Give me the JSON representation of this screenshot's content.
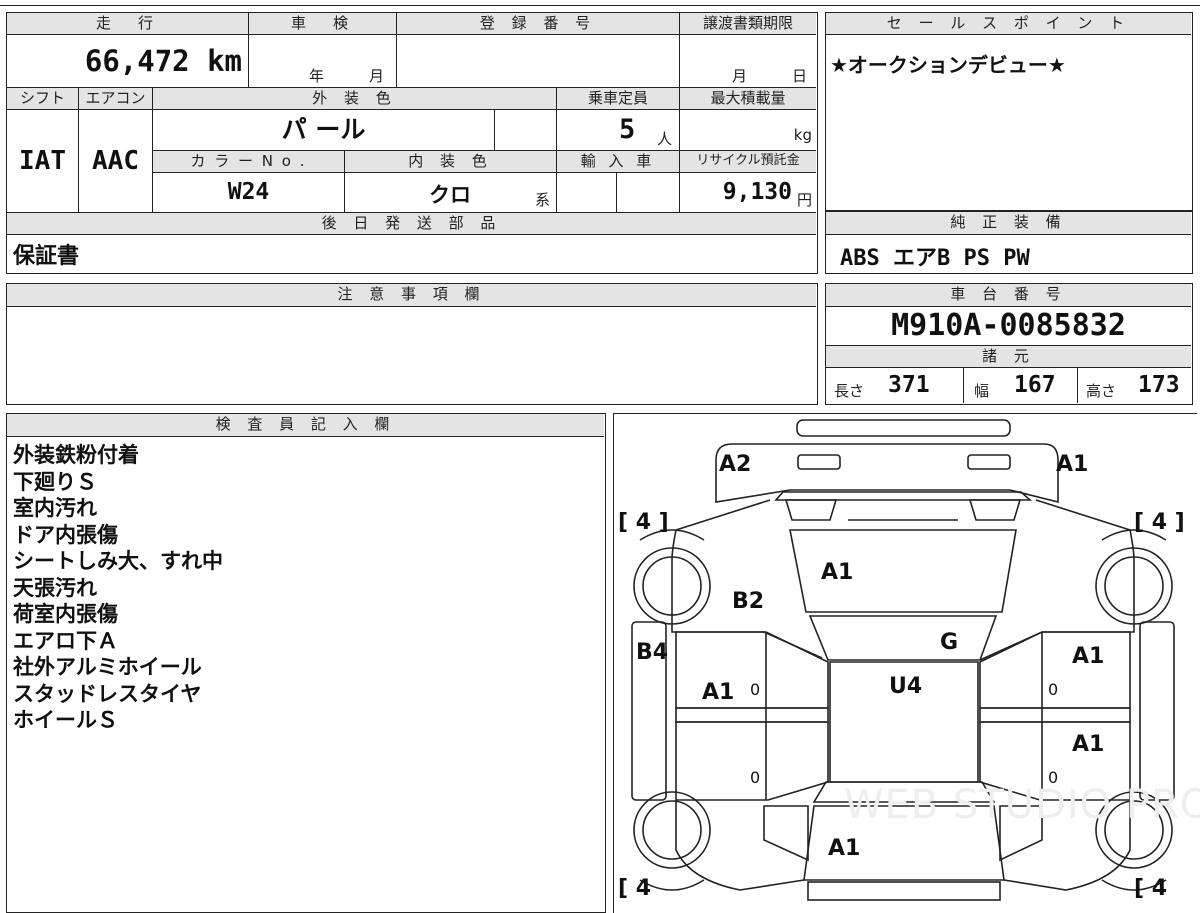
{
  "top_section": {
    "headers": {
      "mileage": "走　行",
      "inspection": "車　検",
      "registration": "登 録 番 号",
      "transfer_deadline": "譲渡書類期限",
      "shift": "シフト",
      "aircon": "エアコン",
      "exterior_color": "外 装 色",
      "capacity": "乗車定員",
      "max_load": "最大積載量",
      "color_no": "カ ラ ー N o .",
      "interior_color": "内 装 色",
      "import": "輸 入 車",
      "recycle": "リサイクル預託金",
      "later_parts": "後 日 発 送 部 品"
    },
    "values": {
      "mileage": "66,472 km",
      "inspection_year_unit": "年",
      "inspection_month_unit": "月",
      "transfer_month_unit": "月",
      "transfer_day_unit": "日",
      "shift": "IAT",
      "aircon": "AAC",
      "exterior_color": "パ ール",
      "capacity": "5",
      "capacity_unit": "人",
      "max_load_unit": "kg",
      "color_no": "W24",
      "interior_color": "クロ",
      "interior_suffix": "系",
      "recycle": "9,130",
      "recycle_unit": "円",
      "later_parts": "保証書"
    }
  },
  "sales_point": {
    "header": "セ ー ル ス ポ イ ン ト",
    "text": "★オークションデビュー★"
  },
  "genuine_equipment": {
    "header": "純 正 装 備",
    "text": "ABS エアB PS PW"
  },
  "caution": {
    "header": "注 意 事 項 欄",
    "text": ""
  },
  "chassis": {
    "header": "車 台 番 号",
    "number": "M910A-0085832",
    "spec_header": "諸 元",
    "length_label": "長さ",
    "length": "371",
    "width_label": "幅",
    "width": "167",
    "height_label": "高さ",
    "height": "173"
  },
  "inspector": {
    "header": "検 査 員 記 入 欄",
    "notes": [
      "外装鉄粉付着",
      "下廻りＳ",
      "室内汚れ",
      "ドア内張傷",
      "シートしみ大、すれ中",
      "天張汚れ",
      "荷室内張傷",
      "エアロ下Ａ",
      "社外アルミホイール",
      "スタッドレスタイヤ",
      "ホイールＳ"
    ]
  },
  "diagram": {
    "marks": {
      "front_left": "A2",
      "front_right": "A1",
      "hood": "A1",
      "left_fender": "B2",
      "windshield": "G",
      "left_sill": "B4",
      "left_front_door": "A1",
      "right_front_door": "A1",
      "roof": "U4",
      "right_rear_door": "A1",
      "rear": "A1"
    },
    "tire_tl": "[ 4 ]",
    "tire_tr": "[ 4 ]",
    "tire_bl": "[ 4",
    "tire_br": "[ 4",
    "zero_mark": "0",
    "watermark": "WEB STUDIO PRO"
  }
}
